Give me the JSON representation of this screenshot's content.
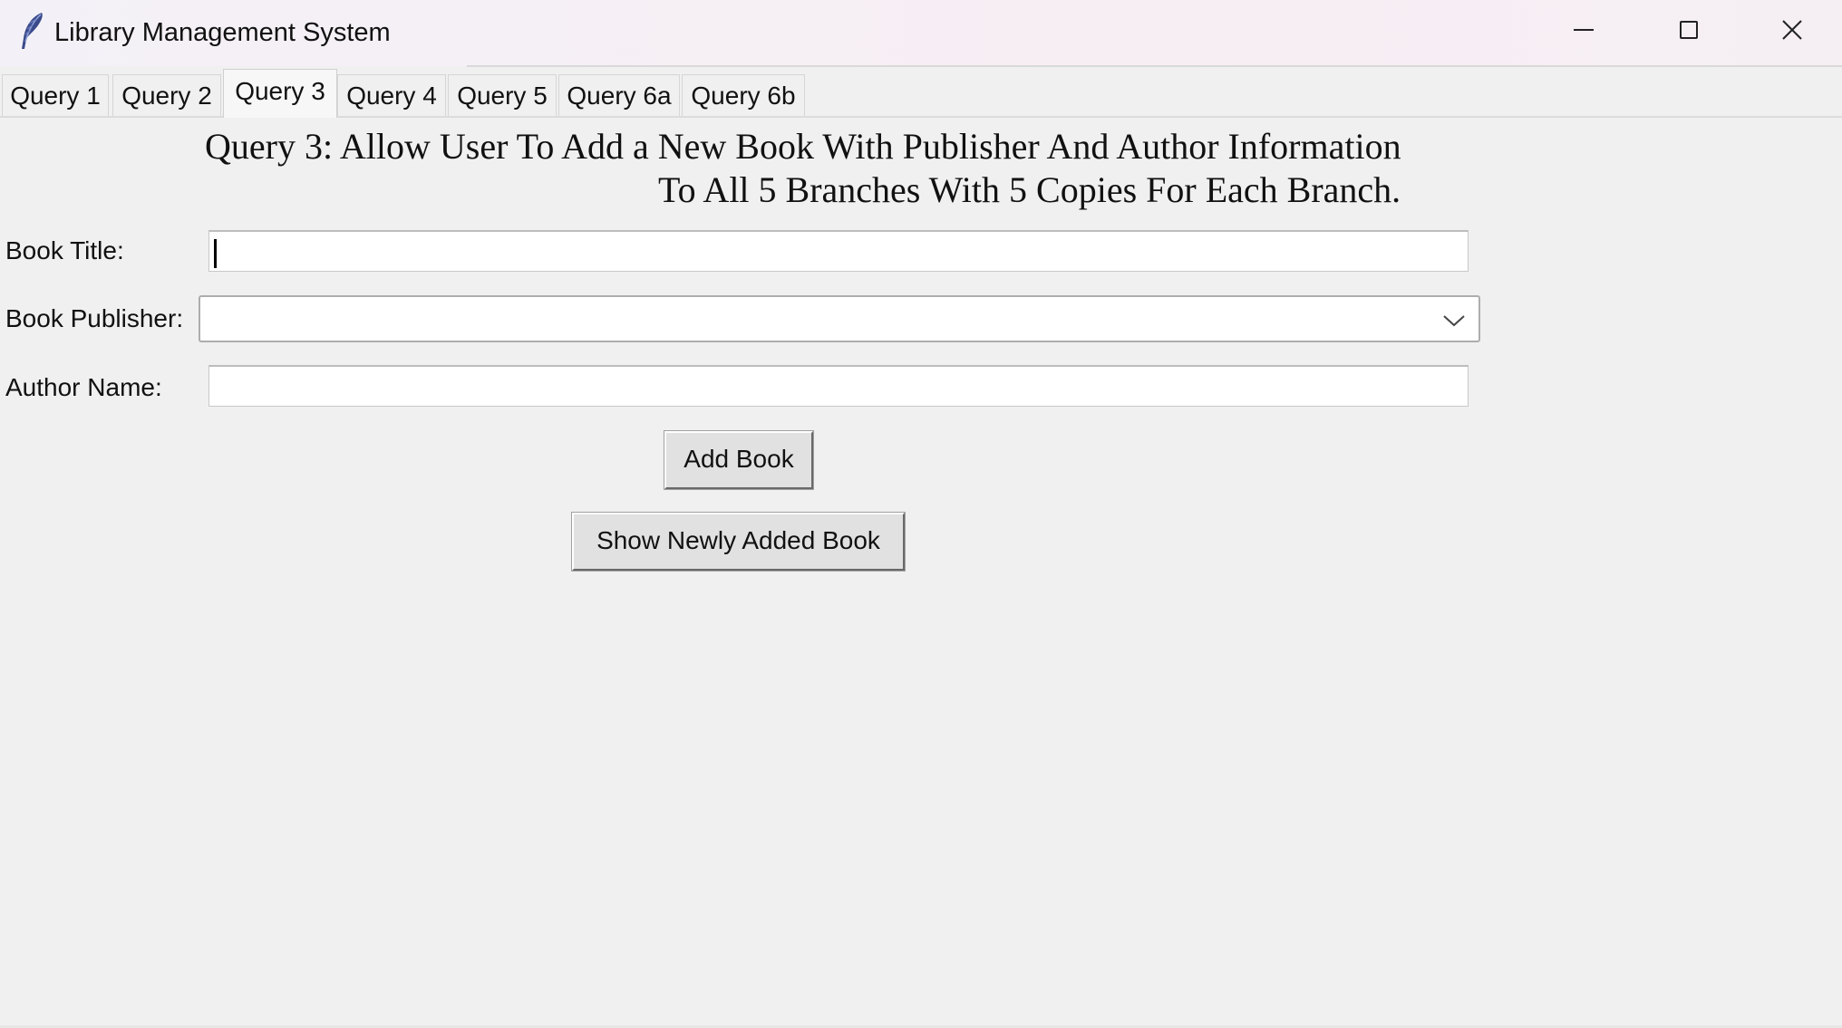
{
  "window": {
    "title": "Library Management System",
    "icon": "feather-icon",
    "controls": [
      "minimize-icon",
      "maximize-icon",
      "close-icon"
    ]
  },
  "tabs": [
    {
      "label": "Query 1",
      "active": false
    },
    {
      "label": "Query 2",
      "active": false
    },
    {
      "label": "Query 3",
      "active": true
    },
    {
      "label": "Query 4",
      "active": false
    },
    {
      "label": "Query 5",
      "active": false
    },
    {
      "label": "Query 6a",
      "active": false
    },
    {
      "label": "Query 6b",
      "active": false
    }
  ],
  "query3": {
    "heading_line1": "Query 3: Allow User To Add a New Book With Publisher And Author Information",
    "heading_line2": "To All 5 Branches With 5 Copies For Each Branch.",
    "fields": {
      "title_label": "Book Title:",
      "title_value": "",
      "publisher_label": "Book Publisher:",
      "publisher_value": "",
      "author_label": "Author Name:",
      "author_value": ""
    },
    "buttons": {
      "add": "Add Book",
      "show": "Show Newly Added Book"
    }
  }
}
